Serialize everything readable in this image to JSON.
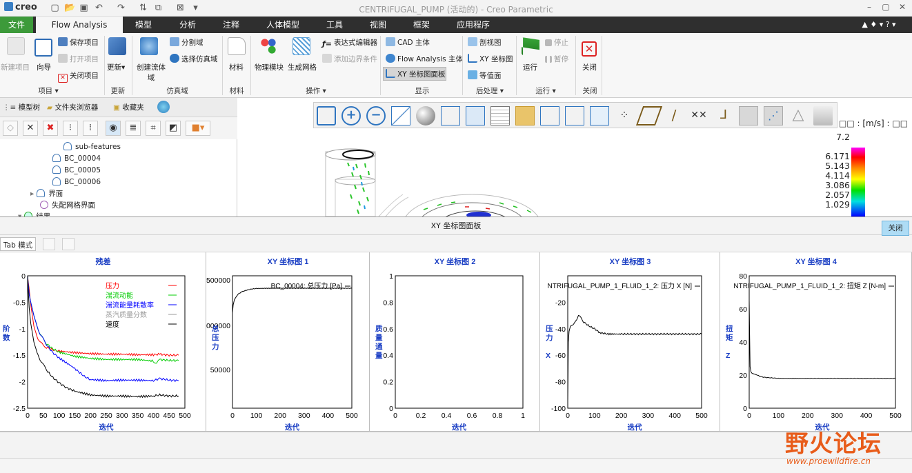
{
  "titlebar": {
    "logo": "creo",
    "title": "CENTRIFUGAL_PUMP (活动的) - Creo Parametric"
  },
  "menubar": {
    "tabs": [
      "文件",
      "Flow Analysis",
      "模型",
      "分析",
      "注释",
      "人体模型",
      "工具",
      "视图",
      "框架",
      "应用程序"
    ]
  },
  "ribbon": {
    "new_project": "新建项目",
    "wizard": "向导",
    "save_project": "保存项目",
    "open_project": "打开项目",
    "close_project": "关闭项目",
    "group_project": "项目 ▾",
    "update": "更新▾",
    "group_update": "更新",
    "create_flow_domain": "创建流体域",
    "split_domain": "分割域",
    "select_sim_domain": "选择仿真域",
    "group_sim_domain": "仿真域",
    "material": "材料",
    "group_material": "材料",
    "physics_module": "物理模块",
    "generate_mesh": "生成网格",
    "expression_editor": "表达式编辑器",
    "add_boundary": "添加边界条件",
    "group_operation": "操作 ▾",
    "cad_body": "CAD 主体",
    "flow_body": "Flow Analysis 主体",
    "xy_panel": "XY 坐标图面板",
    "group_display": "显示",
    "section_view": "剖视图",
    "xy_plot": "XY 坐标图",
    "isosurface": "等值面",
    "group_post": "后处理 ▾",
    "run": "运行",
    "stop": "停止",
    "pause": "暂停",
    "group_run": "运行 ▾",
    "close": "关闭",
    "group_close": "关闭"
  },
  "navtabs": {
    "model_tree": "模型树",
    "folder_browser": "文件夹浏览器",
    "favorites": "收藏夹"
  },
  "tree": [
    "sub-features",
    "BC_00004",
    "BC_00005",
    "BC_00006",
    "界面",
    "失配网格界面",
    "结果"
  ],
  "legend": {
    "header": "□□ : [m/s] : □□",
    "values": [
      "7.2",
      "6.171",
      "5.143",
      "4.114",
      "3.086",
      "2.057",
      "1.029"
    ]
  },
  "xy_panel": {
    "title": "XY 坐标图面板",
    "tab_mode": "Tab 模式",
    "close_label": "关闭"
  },
  "chart_data": [
    {
      "type": "line",
      "title": "残差",
      "xlabel": "迭代",
      "ylabel": "阶数",
      "xlim": [
        0,
        500
      ],
      "ylim": [
        -2.5,
        0
      ],
      "x_ticks": [
        "0",
        "50",
        "100",
        "150",
        "200",
        "250",
        "300",
        "350",
        "400",
        "450",
        "500"
      ],
      "y_ticks": [
        "0",
        "-0.5",
        "-1",
        "-1.5",
        "-2",
        "-2.5"
      ],
      "series": [
        {
          "name": "压力",
          "color": "#ff0000",
          "x": [
            0,
            5,
            10,
            20,
            30,
            40,
            50,
            60,
            80,
            100,
            150,
            200,
            250,
            300,
            350,
            400,
            420,
            450,
            480
          ],
          "y": [
            0,
            -0.25,
            -0.55,
            -0.95,
            -1.15,
            -1.25,
            -1.32,
            -1.35,
            -1.4,
            -1.42,
            -1.45,
            -1.47,
            -1.48,
            -1.48,
            -1.49,
            -1.49,
            -1.48,
            -1.5,
            -1.5
          ]
        },
        {
          "name": "湍流动能",
          "color": "#00cc00",
          "x": [
            0,
            5,
            10,
            20,
            30,
            40,
            50,
            60,
            80,
            100,
            150,
            200,
            250,
            300,
            350,
            400,
            410,
            420,
            450,
            480
          ],
          "y": [
            0,
            -0.35,
            -0.5,
            -0.75,
            -0.95,
            -1.1,
            -1.2,
            -1.28,
            -1.38,
            -1.44,
            -1.52,
            -1.56,
            -1.58,
            -1.58,
            -1.58,
            -1.61,
            -1.66,
            -1.58,
            -1.6,
            -1.6
          ]
        },
        {
          "name": "湍流能量耗散率",
          "color": "#0000ff",
          "x": [
            0,
            5,
            10,
            20,
            30,
            40,
            50,
            60,
            80,
            100,
            150,
            180,
            200,
            250,
            300,
            350,
            400,
            420,
            450,
            480
          ],
          "y": [
            0,
            -0.35,
            -0.5,
            -0.75,
            -0.95,
            -1.1,
            -1.2,
            -1.3,
            -1.45,
            -1.55,
            -1.75,
            -1.9,
            -1.96,
            -1.98,
            -1.97,
            -1.97,
            -1.98,
            -1.94,
            -1.97,
            -1.98
          ]
        },
        {
          "name": "蒸汽质量分数",
          "color": "#999999",
          "x": [],
          "y": []
        },
        {
          "name": "速度",
          "color": "#000000",
          "x": [
            0,
            5,
            10,
            20,
            30,
            40,
            50,
            60,
            80,
            100,
            120,
            150,
            200,
            250,
            300,
            350,
            400,
            420,
            450,
            480
          ],
          "y": [
            0,
            -0.6,
            -0.9,
            -1.25,
            -1.45,
            -1.58,
            -1.68,
            -1.78,
            -1.92,
            -2.02,
            -2.1,
            -2.18,
            -2.25,
            -2.27,
            -2.27,
            -2.28,
            -2.27,
            -2.25,
            -2.27,
            -2.27
          ]
        }
      ]
    },
    {
      "type": "line",
      "title": "XY 坐标图 1",
      "xlabel": "迭代",
      "ylabel": "总压力",
      "xlim": [
        0,
        500
      ],
      "ylim": [
        0,
        500000
      ],
      "x_ticks": [
        "0",
        "100",
        "200",
        "300",
        "400",
        "500"
      ],
      "y_ticks": [
        "500000",
        "000000",
        "50000"
      ],
      "series": [
        {
          "name": "BC_00004: 总压力 [Pa]",
          "color": "#000000",
          "x": [
            0,
            3,
            8,
            15,
            25,
            40,
            60,
            80,
            100,
            150,
            200,
            300,
            400,
            500
          ],
          "y": [
            360000,
            390000,
            410000,
            420000,
            432000,
            440000,
            446000,
            450000,
            452000,
            453000,
            453000,
            453000,
            453000,
            453000
          ]
        }
      ]
    },
    {
      "type": "line",
      "title": "XY 坐标图 2",
      "xlabel": "迭代",
      "ylabel": "质量通量",
      "xlim": [
        0,
        1
      ],
      "ylim": [
        0,
        1
      ],
      "x_ticks": [
        "0",
        "0.2",
        "0.4",
        "0.6",
        "0.8",
        "1"
      ],
      "y_ticks": [
        "0",
        "0.2",
        "0.4",
        "0.6",
        "0.8",
        "1"
      ],
      "series": []
    },
    {
      "type": "line",
      "title": "XY 坐标图 3",
      "xlabel": "迭代",
      "ylabel": "压力 X",
      "xlim": [
        0,
        500
      ],
      "ylim": [
        -100,
        0
      ],
      "x_ticks": [
        "0",
        "100",
        "200",
        "300",
        "400",
        "500"
      ],
      "y_ticks": [
        "-100",
        "-80",
        "-60",
        "-40",
        "-20"
      ],
      "series": [
        {
          "name": "NTRIFUGAL_PUMP_1_FLUID_1_2: 压力 X [N]",
          "color": "#000000",
          "x": [
            0,
            2,
            5,
            10,
            20,
            30,
            40,
            50,
            60,
            80,
            100,
            120,
            150,
            200,
            300,
            400,
            500
          ],
          "y": [
            -95,
            -50,
            -42,
            -38,
            -37,
            -34,
            -30,
            -32,
            -35,
            -38,
            -40,
            -43,
            -44,
            -44,
            -44,
            -44,
            -44
          ]
        }
      ]
    },
    {
      "type": "line",
      "title": "XY 坐标图 4",
      "xlabel": "迭代",
      "ylabel": "扭矩 Z",
      "xlim": [
        0,
        500
      ],
      "ylim": [
        0,
        80
      ],
      "x_ticks": [
        "0",
        "100",
        "200",
        "300",
        "400",
        "500"
      ],
      "y_ticks": [
        "0",
        "20",
        "40",
        "60",
        "80"
      ],
      "series": [
        {
          "name": "NTRIFUGAL_PUMP_1_FLUID_1_2: 扭矩 Z [N-m]",
          "color": "#000000",
          "x": [
            0,
            3,
            6,
            10,
            20,
            40,
            60,
            80,
            100,
            150,
            200,
            300,
            400,
            500
          ],
          "y": [
            65,
            25,
            22,
            21,
            20.5,
            19,
            18.5,
            18.3,
            18,
            18,
            18,
            18,
            18,
            18
          ]
        }
      ]
    }
  ],
  "watermark": {
    "cn": "野火论坛",
    "url": "www.proewildfire.cn"
  }
}
